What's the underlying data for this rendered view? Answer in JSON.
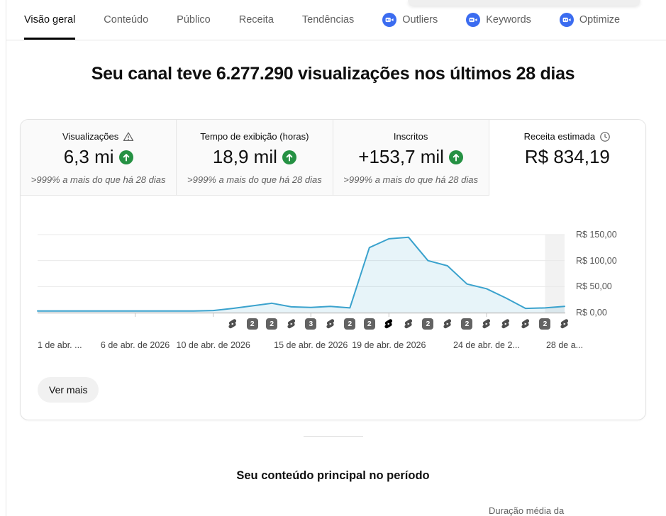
{
  "tabs": {
    "items": [
      {
        "label": "Visão geral",
        "active": true
      },
      {
        "label": "Conteúdo",
        "active": false
      },
      {
        "label": "Público",
        "active": false
      },
      {
        "label": "Receita",
        "active": false
      },
      {
        "label": "Tendências",
        "active": false
      },
      {
        "label": "Outliers",
        "active": false,
        "icon": "vidiq-icon"
      },
      {
        "label": "Keywords",
        "active": false,
        "icon": "vidiq-icon"
      },
      {
        "label": "Optimize",
        "active": false,
        "icon": "vidiq-icon"
      }
    ]
  },
  "title": "Seu canal teve 6.277.290 visualizações nos últimos 28 dias",
  "metrics": [
    {
      "label": "Visualizações",
      "icon": "warning-icon",
      "value": "6,3 mi",
      "trend": "up",
      "delta": ">999% a mais do que há 28 dias",
      "selected": false
    },
    {
      "label": "Tempo de exibição (horas)",
      "value": "18,9 mil",
      "trend": "up",
      "delta": ">999% a mais do que há 28 dias",
      "selected": false
    },
    {
      "label": "Inscritos",
      "value": "+153,7 mil",
      "trend": "up",
      "delta": ">999% a mais do que há 28 dias",
      "selected": false
    },
    {
      "label": "Receita estimada",
      "icon": "clock-icon",
      "value": "R$ 834,19",
      "selected": true
    }
  ],
  "chart_data": {
    "type": "line",
    "series_name": "Receita estimada (R$) por dia",
    "ylim": [
      0,
      150
    ],
    "grid": true,
    "legend_position": "none",
    "y_axis": [
      {
        "value": 150,
        "label": "R$ 150,00"
      },
      {
        "value": 100,
        "label": "R$ 100,00"
      },
      {
        "value": 50,
        "label": "R$ 50,00"
      },
      {
        "value": 0,
        "label": "R$ 0,00"
      }
    ],
    "x_axis": [
      {
        "day": 1,
        "label": "1 de abr. ...",
        "align": "left",
        "tick": false
      },
      {
        "day": 6,
        "label": "6 de abr. de 2026",
        "tick": true
      },
      {
        "day": 10,
        "label": "10 de abr. de 2026",
        "tick": true
      },
      {
        "day": 15,
        "label": "15 de abr. de 2026",
        "tick": true
      },
      {
        "day": 19,
        "label": "19 de abr. de 2026",
        "tick": true
      },
      {
        "day": 24,
        "label": "24 de abr. de 2...",
        "tick": true
      },
      {
        "day": 28,
        "label": "28 de a...",
        "tick": false
      }
    ],
    "days": [
      1,
      2,
      3,
      4,
      5,
      6,
      7,
      8,
      9,
      10,
      11,
      12,
      13,
      14,
      15,
      16,
      17,
      18,
      19,
      20,
      21,
      22,
      23,
      24,
      25,
      26,
      27,
      28
    ],
    "values": [
      3,
      3,
      3,
      3,
      3,
      3,
      3,
      3,
      3,
      4,
      8,
      13,
      18,
      11,
      10,
      12,
      9,
      125,
      142,
      145,
      100,
      90,
      55,
      46,
      28,
      8,
      9,
      12
    ],
    "markers": [
      {
        "day": 11,
        "type": "shorts"
      },
      {
        "day": 12,
        "type": "count",
        "count": "2"
      },
      {
        "day": 13,
        "type": "count",
        "count": "2"
      },
      {
        "day": 14,
        "type": "shorts"
      },
      {
        "day": 15,
        "type": "count",
        "count": "3"
      },
      {
        "day": 16,
        "type": "shorts"
      },
      {
        "day": 17,
        "type": "count",
        "count": "2"
      },
      {
        "day": 18,
        "type": "count",
        "count": "2"
      },
      {
        "day": 19,
        "type": "shorts",
        "highlight": true
      },
      {
        "day": 20,
        "type": "shorts"
      },
      {
        "day": 21,
        "type": "count",
        "count": "2"
      },
      {
        "day": 22,
        "type": "shorts"
      },
      {
        "day": 23,
        "type": "count",
        "count": "2"
      },
      {
        "day": 24,
        "type": "shorts"
      },
      {
        "day": 25,
        "type": "shorts"
      },
      {
        "day": 26,
        "type": "shorts"
      },
      {
        "day": 27,
        "type": "count",
        "count": "2"
      },
      {
        "day": 28,
        "type": "shorts"
      }
    ],
    "incomplete_region": {
      "start_day": 27,
      "end_day": 28
    },
    "line_color": "#3aa2cd",
    "area_color": "rgba(58,162,205,0.12)",
    "incomplete_band_color": "#f2f2f2"
  },
  "buttons": {
    "ver_mais": "Ver mais"
  },
  "sections": {
    "top_content_heading": "Seu conteúdo principal no período",
    "partial_table_header": "Duração média da"
  },
  "colors": {
    "accent_vidiq_blue": "#3b6cf0",
    "trend_green": "#259143",
    "active_tab_underline": "#030303"
  }
}
